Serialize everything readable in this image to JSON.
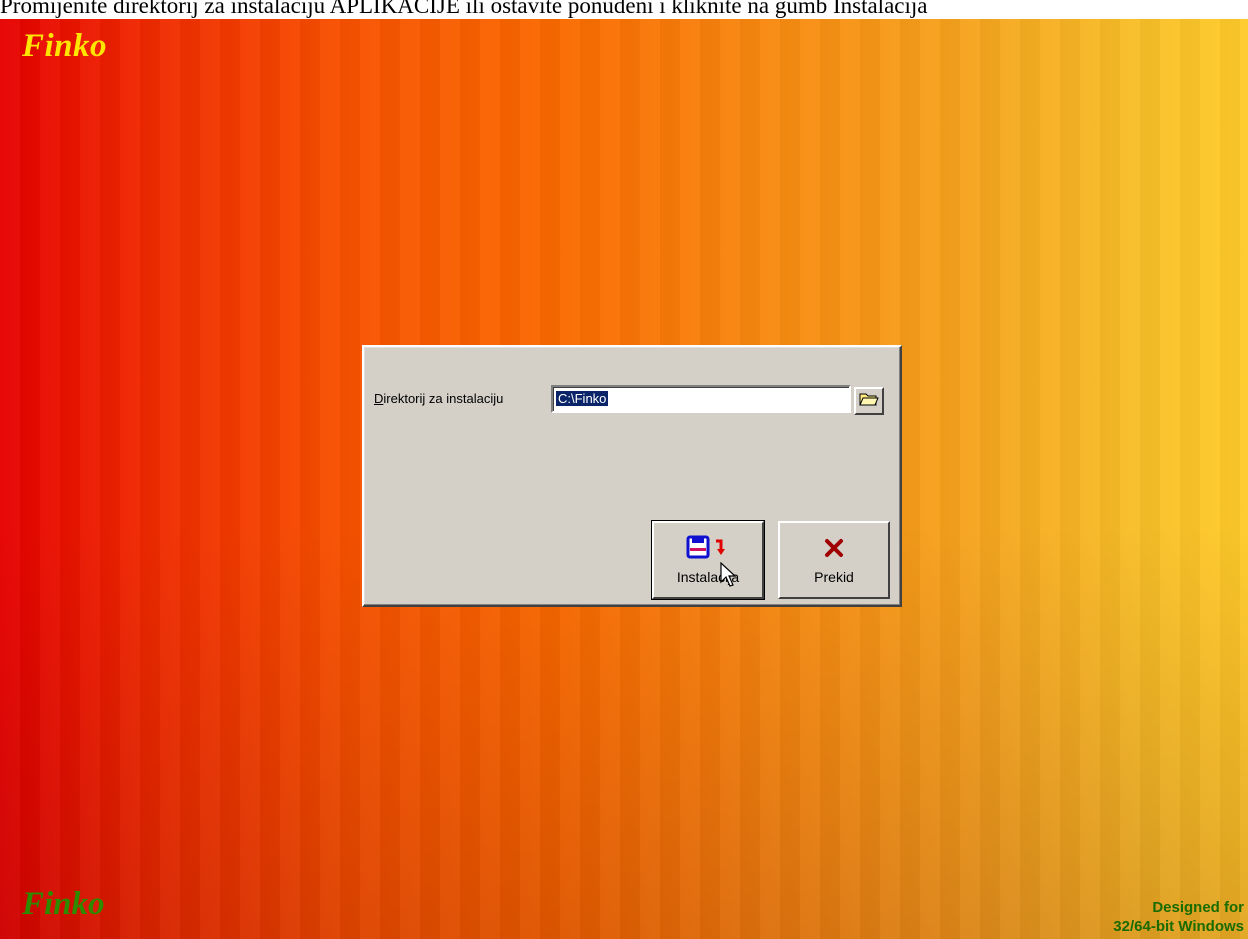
{
  "window_caption": "Promijenite direktorij za instalaciju APLIKACIJE ili ostavite ponuđeni i kliknite na gumb Instalacija",
  "logo_top": "Finko",
  "logo_bottom": "Finko",
  "designed_line1": "Designed for",
  "designed_line2": "32/64-bit Windows",
  "dialog": {
    "dir_label": "Direktorij za instalaciju",
    "dir_value": "C:\\Finko",
    "browse_icon": "folder-open-icon",
    "install_label": "Instalacija",
    "install_icon": "floppy-install-icon",
    "cancel_label": "Prekid",
    "cancel_icon": "red-x-icon"
  },
  "colors": {
    "logo_top": "#ffe600",
    "logo_bottom": "#2e8b00",
    "dialog_bg": "#d4d0c8",
    "selection": "#0a246a"
  }
}
